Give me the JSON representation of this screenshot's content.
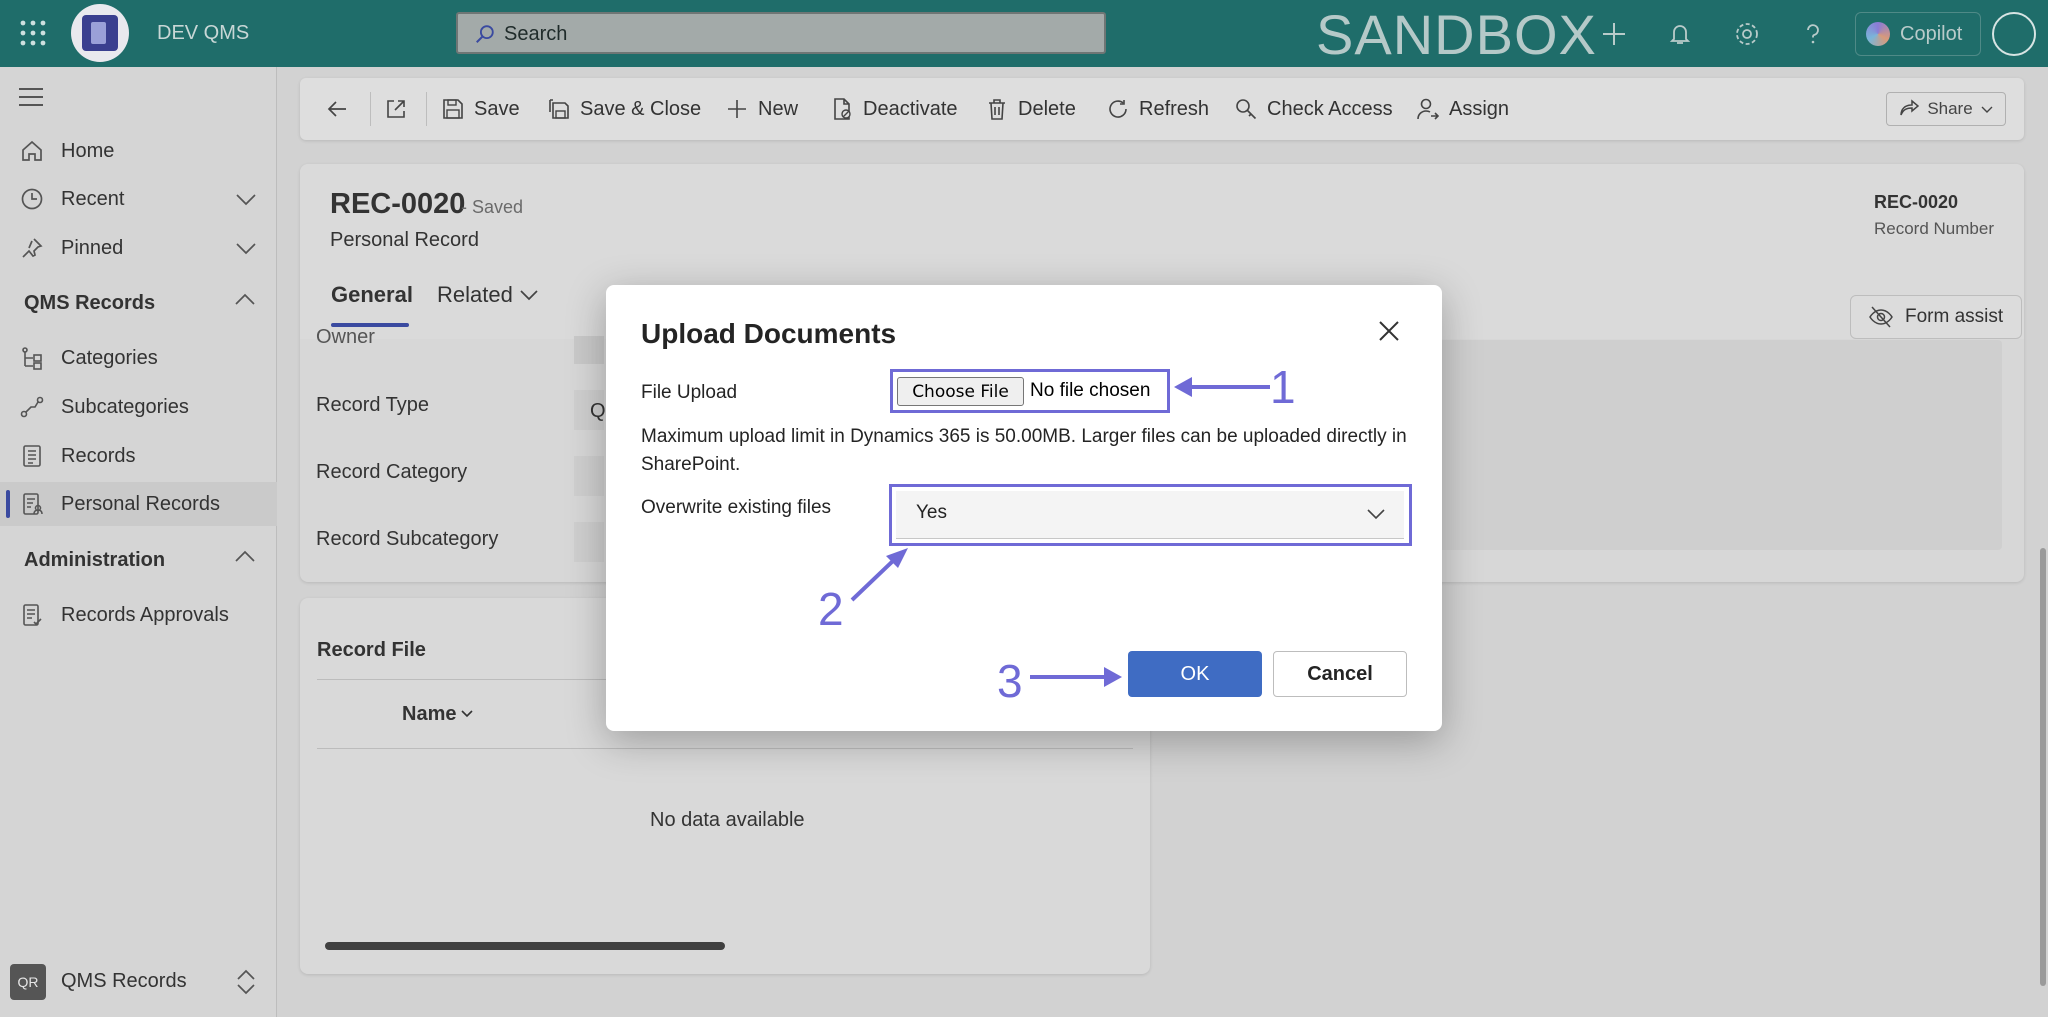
{
  "topbar": {
    "app_name": "DEV QMS",
    "search_placeholder": "Search",
    "environment": "SANDBOX",
    "copilot_label": "Copilot"
  },
  "sidebar": {
    "items": [
      {
        "label": "Home",
        "icon": "home-icon"
      },
      {
        "label": "Recent",
        "icon": "clock-icon"
      },
      {
        "label": "Pinned",
        "icon": "pin-icon"
      }
    ],
    "section_qms": "QMS Records",
    "qms_items": [
      {
        "label": "Categories",
        "icon": "categories-icon"
      },
      {
        "label": "Subcategories",
        "icon": "subcategories-icon"
      },
      {
        "label": "Records",
        "icon": "records-icon"
      },
      {
        "label": "Personal Records",
        "icon": "personal-records-icon",
        "active": true
      }
    ],
    "section_admin": "Administration",
    "admin_items": [
      {
        "label": "Records Approvals",
        "icon": "approvals-icon"
      }
    ],
    "area": {
      "badge": "QR",
      "label": "QMS Records"
    }
  },
  "commandbar": {
    "save": "Save",
    "save_close": "Save & Close",
    "new": "New",
    "deactivate": "Deactivate",
    "delete": "Delete",
    "refresh": "Refresh",
    "check_access": "Check Access",
    "assign": "Assign",
    "share": "Share"
  },
  "record": {
    "id": "REC-0020",
    "status": "- Saved",
    "entity": "Personal Record",
    "number_value": "REC-0020",
    "number_label": "Record Number",
    "tabs": [
      "General",
      "Related"
    ],
    "form_assist": "Form assist",
    "fields": {
      "owner": "Owner",
      "type": "Record Type",
      "type_value": "Q",
      "category": "Record Category",
      "subcategory": "Record Subcategory"
    }
  },
  "record_file": {
    "title": "Record File",
    "column_name": "Name",
    "empty": "No data available"
  },
  "dialog": {
    "title": "Upload Documents",
    "file_upload_label": "File Upload",
    "choose_file": "Choose File",
    "no_file": "No file chosen",
    "note": "Maximum upload limit in Dynamics 365 is 50.00MB. Larger files can be uploaded directly in SharePoint.",
    "overwrite_label": "Overwrite existing files",
    "overwrite_value": "Yes",
    "ok": "OK",
    "cancel": "Cancel"
  },
  "callouts": [
    "1",
    "2",
    "3"
  ],
  "colors": {
    "topbar": "#1f6d6a",
    "accent": "#3f6cc3",
    "callout": "#6f6ad6"
  }
}
